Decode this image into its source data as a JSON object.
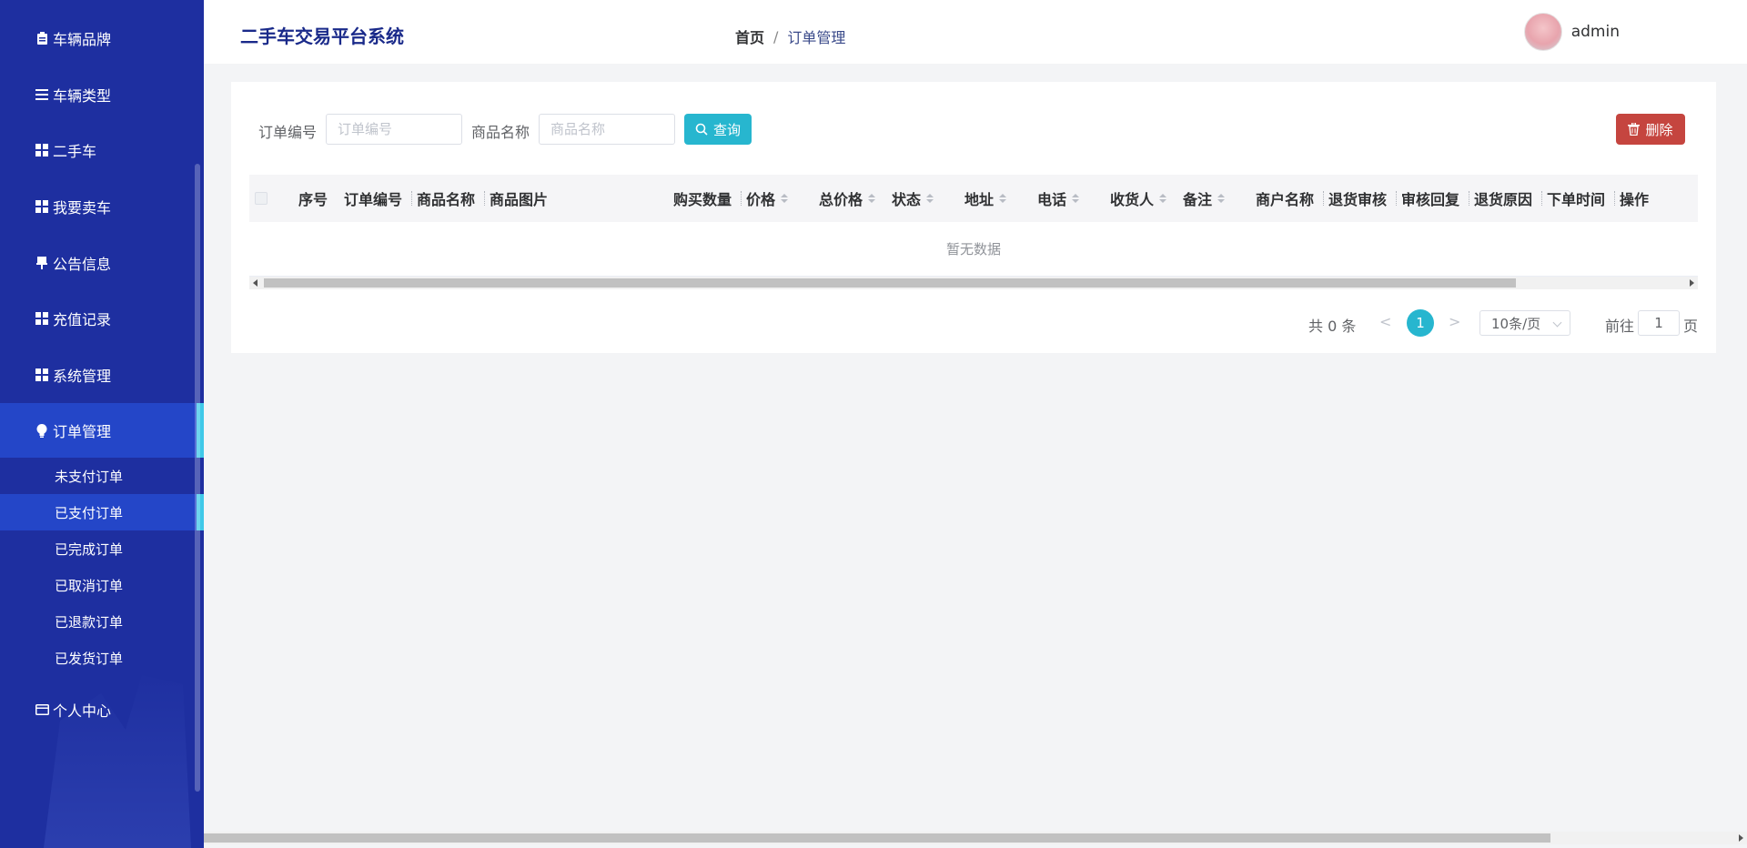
{
  "sidebar": {
    "items": [
      {
        "label": "车辆品牌",
        "icon": "clipboard-icon"
      },
      {
        "label": "车辆类型",
        "icon": "list-icon"
      },
      {
        "label": "二手车",
        "icon": "grid-icon"
      },
      {
        "label": "我要卖车",
        "icon": "grid-icon"
      },
      {
        "label": "公告信息",
        "icon": "pin-icon"
      },
      {
        "label": "充值记录",
        "icon": "grid-icon"
      },
      {
        "label": "系统管理",
        "icon": "grid-icon"
      },
      {
        "label": "订单管理",
        "icon": "bulb-icon"
      }
    ],
    "submenu": [
      {
        "label": "未支付订单"
      },
      {
        "label": "已支付订单"
      },
      {
        "label": "已完成订单"
      },
      {
        "label": "已取消订单"
      },
      {
        "label": "已退款订单"
      },
      {
        "label": "已发货订单"
      }
    ],
    "personal": {
      "label": "个人中心",
      "icon": "card-icon"
    },
    "active_item": "订单管理",
    "active_sub": "已支付订单"
  },
  "header": {
    "title": "二手车交易平台系统",
    "breadcrumb": {
      "home": "首页",
      "separator": "/",
      "current": "订单管理"
    },
    "user": "admin"
  },
  "filters": {
    "order_no_label": "订单编号",
    "order_no_placeholder": "订单编号",
    "product_name_label": "商品名称",
    "product_name_placeholder": "商品名称",
    "search_label": "查询",
    "delete_label": "删除"
  },
  "table": {
    "columns": [
      "序号",
      "订单编号",
      "商品名称",
      "商品图片",
      "购买数量",
      "价格",
      "总价格",
      "状态",
      "地址",
      "电话",
      "收货人",
      "备注",
      "商户名称",
      "退货审核",
      "审核回复",
      "退货原因",
      "下单时间",
      "操作"
    ],
    "empty_text": "暂无数据"
  },
  "pagination": {
    "total_text": "共 0 条",
    "prev": "<",
    "current_page": "1",
    "next": ">",
    "page_size": "10条/页",
    "goto_label": "前往",
    "goto_value": "1",
    "page_suffix": "页"
  },
  "colors": {
    "sidebar_bg": "#1e2fa0",
    "sidebar_active": "#2446c8",
    "accent_cyan": "#27b6cf",
    "delete_red": "#c5453f"
  }
}
